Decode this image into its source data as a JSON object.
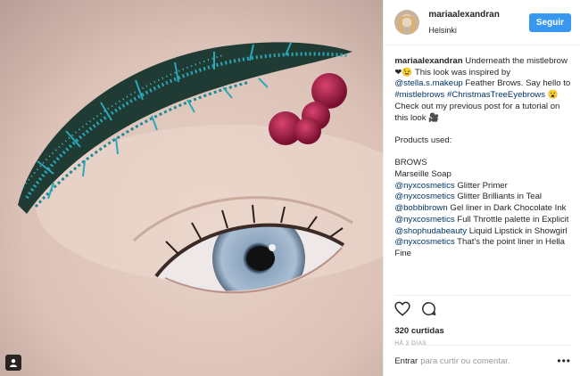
{
  "header": {
    "username": "mariaalexandran",
    "location": "Helsinki",
    "follow_label": "Seguir"
  },
  "caption": {
    "username": "mariaalexandran",
    "intro_1": " Underneath the mistlebrow ",
    "intro_2": " This look was inspired by ",
    "mention_stella": "@stella.s.makeup",
    "intro_3": " Feather Brows. Say hello to ",
    "hashtag_1": "#mistlebrows",
    "hashtag_2": "#ChristmasTreeEyebrows",
    "intro_4": " Check out my previous post for a tutorial on this look ",
    "products_heading": "Products used:",
    "section": "BROWS",
    "line_soap": "Marseille Soap",
    "mention_nyx": "@nyxcosmetics",
    "line_primer": " Glitter Primer",
    "line_brilliants": " Glitter Brilliants in Teal",
    "mention_bobbi": "@bobbibrown",
    "line_gel": " Gel liner in Dark Chocolate Ink",
    "line_palette": " Full Throttle palette in Explicit",
    "mention_huda": "@shophudabeauty",
    "line_lipstick": " Liquid Lipstick in Showgirl",
    "line_pointliner": " That's the point liner in Hella Fine"
  },
  "likes": "320 curtidas",
  "timestamp": "HÁ 3 DIAS",
  "comment": {
    "login_label": "Entrar",
    "prompt": "para curtir ou comentar.",
    "more_label": "•••"
  },
  "icons": {
    "heart": "heart-icon",
    "comment": "comment-icon",
    "emoji_heart": "❤",
    "emoji_wink": "😉",
    "emoji_face": "😮",
    "emoji_camera": "🎥"
  },
  "colors": {
    "follow_button": "#3897f0",
    "link": "#003569",
    "glitter_teal": "#2aa7b8",
    "berry": "#b5204a"
  }
}
